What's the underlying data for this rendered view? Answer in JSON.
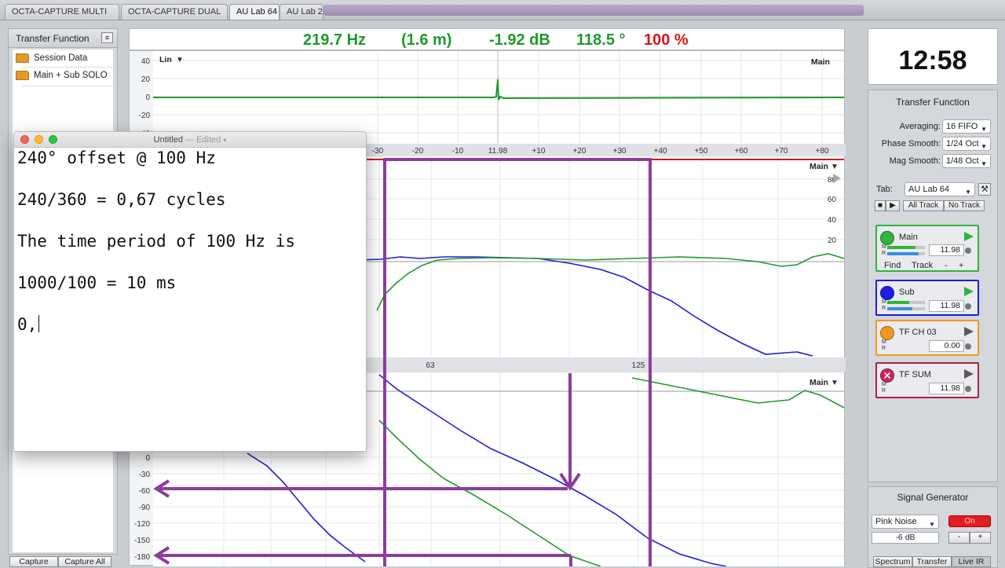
{
  "tabs": [
    {
      "label": "OCTA-CAPTURE MULTI",
      "active": false
    },
    {
      "label": "OCTA-CAPTURE DUAL",
      "active": false
    },
    {
      "label": "AU Lab 64",
      "active": true
    },
    {
      "label": "AU Lab 2",
      "active": false
    }
  ],
  "left_panel": {
    "title": "Transfer Function",
    "menu_icon": "list-icon",
    "items": [
      "Session Data",
      "Main + Sub SOLO"
    ],
    "buttons": [
      "Capture",
      "Capture All"
    ]
  },
  "readout": {
    "frequency": "219.7 Hz",
    "distance": "(1.6 m)",
    "magnitude": "-1.92 dB",
    "phase": "118.5 °",
    "coherence": "100 %"
  },
  "impulse_plot": {
    "scale_label": "Lin",
    "track_label": "Main",
    "y_ticks": [
      "40",
      "20",
      "0",
      "-20",
      "-40"
    ],
    "x_ticks": [
      "-30",
      "-20",
      "-10",
      "11.98",
      "+10",
      "+20",
      "+30",
      "+40",
      "+50",
      "+60",
      "+70",
      "+80"
    ]
  },
  "magnitude_plot": {
    "track_label": "Main",
    "y_ticks": [
      "80",
      "60",
      "40",
      "20"
    ],
    "x_ticks": [
      "63",
      "125"
    ]
  },
  "phase_plot": {
    "track_label": "Main",
    "y_ticks": [
      "0",
      "-30",
      "-60",
      "-90",
      "-120",
      "-150",
      "-180"
    ]
  },
  "clock": "12:58",
  "transfer_panel": {
    "title": "Transfer Function",
    "averaging": {
      "label": "Averaging:",
      "value": "16 FIFO"
    },
    "phase_smooth": {
      "label": "Phase Smooth:",
      "value": "1/24 Oct"
    },
    "mag_smooth": {
      "label": "Mag Smooth:",
      "value": "1/48 Oct"
    },
    "tab": {
      "label": "Tab:",
      "value": "AU Lab 64"
    },
    "tools_icon": "tools-icon",
    "transport": {
      "stop_icon": "stop-icon",
      "play_icon": "play-icon",
      "all_track": "All Track",
      "no_track": "No Track"
    },
    "tracks": [
      {
        "name": "Main",
        "delay": "11.98",
        "color": "#2fb53a",
        "dot": "#2fb53a",
        "active": true,
        "find": "Find",
        "track": "Track",
        "minus": "-",
        "plus": "+"
      },
      {
        "name": "Sub",
        "delay": "11.98",
        "color": "#1d1de0",
        "dot": "#1d1de0",
        "active": true
      },
      {
        "name": "TF CH 03",
        "delay": "0.00",
        "color": "#f09a1e",
        "dot": "#f09a1e",
        "active": false
      },
      {
        "name": "TF SUM",
        "delay": "11.98",
        "color": "#b01e4a",
        "dot": "#c22a63",
        "active": false
      }
    ]
  },
  "signal_generator": {
    "title": "Signal Generator",
    "type": "Pink Noise",
    "power": "On",
    "level": "-6 dB",
    "minus": "-",
    "plus": "+"
  },
  "bottom_tabs": [
    "Spectrum",
    "Transfer",
    "Live IR"
  ],
  "editor": {
    "title": "Untitled",
    "status": "— Edited",
    "lines": [
      "240° offset @ 100 Hz",
      "240/360 = 0,67 cycles",
      "The time period of 100 Hz is",
      "1000/100 = 10 ms",
      "0,"
    ]
  },
  "colors": {
    "trace_green": "#1f9a2b",
    "trace_blue": "#1d1de0",
    "trace_red": "#d8161b",
    "annotation_purple": "#8d3d9a",
    "readout_green": "#1f9a2b",
    "readout_red": "#d8161b"
  }
}
